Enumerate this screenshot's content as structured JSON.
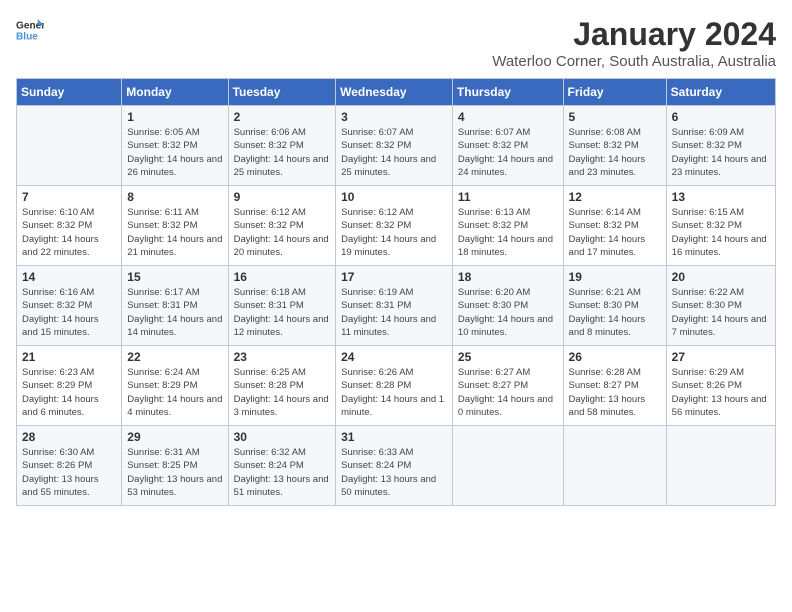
{
  "logo": {
    "general": "General",
    "blue": "Blue"
  },
  "title": "January 2024",
  "subtitle": "Waterloo Corner, South Australia, Australia",
  "days": [
    "Sunday",
    "Monday",
    "Tuesday",
    "Wednesday",
    "Thursday",
    "Friday",
    "Saturday"
  ],
  "weeks": [
    [
      {
        "day": "",
        "sunrise": "",
        "sunset": "",
        "daylight": ""
      },
      {
        "day": "1",
        "sunrise": "Sunrise: 6:05 AM",
        "sunset": "Sunset: 8:32 PM",
        "daylight": "Daylight: 14 hours and 26 minutes."
      },
      {
        "day": "2",
        "sunrise": "Sunrise: 6:06 AM",
        "sunset": "Sunset: 8:32 PM",
        "daylight": "Daylight: 14 hours and 25 minutes."
      },
      {
        "day": "3",
        "sunrise": "Sunrise: 6:07 AM",
        "sunset": "Sunset: 8:32 PM",
        "daylight": "Daylight: 14 hours and 25 minutes."
      },
      {
        "day": "4",
        "sunrise": "Sunrise: 6:07 AM",
        "sunset": "Sunset: 8:32 PM",
        "daylight": "Daylight: 14 hours and 24 minutes."
      },
      {
        "day": "5",
        "sunrise": "Sunrise: 6:08 AM",
        "sunset": "Sunset: 8:32 PM",
        "daylight": "Daylight: 14 hours and 23 minutes."
      },
      {
        "day": "6",
        "sunrise": "Sunrise: 6:09 AM",
        "sunset": "Sunset: 8:32 PM",
        "daylight": "Daylight: 14 hours and 23 minutes."
      }
    ],
    [
      {
        "day": "7",
        "sunrise": "Sunrise: 6:10 AM",
        "sunset": "Sunset: 8:32 PM",
        "daylight": "Daylight: 14 hours and 22 minutes."
      },
      {
        "day": "8",
        "sunrise": "Sunrise: 6:11 AM",
        "sunset": "Sunset: 8:32 PM",
        "daylight": "Daylight: 14 hours and 21 minutes."
      },
      {
        "day": "9",
        "sunrise": "Sunrise: 6:12 AM",
        "sunset": "Sunset: 8:32 PM",
        "daylight": "Daylight: 14 hours and 20 minutes."
      },
      {
        "day": "10",
        "sunrise": "Sunrise: 6:12 AM",
        "sunset": "Sunset: 8:32 PM",
        "daylight": "Daylight: 14 hours and 19 minutes."
      },
      {
        "day": "11",
        "sunrise": "Sunrise: 6:13 AM",
        "sunset": "Sunset: 8:32 PM",
        "daylight": "Daylight: 14 hours and 18 minutes."
      },
      {
        "day": "12",
        "sunrise": "Sunrise: 6:14 AM",
        "sunset": "Sunset: 8:32 PM",
        "daylight": "Daylight: 14 hours and 17 minutes."
      },
      {
        "day": "13",
        "sunrise": "Sunrise: 6:15 AM",
        "sunset": "Sunset: 8:32 PM",
        "daylight": "Daylight: 14 hours and 16 minutes."
      }
    ],
    [
      {
        "day": "14",
        "sunrise": "Sunrise: 6:16 AM",
        "sunset": "Sunset: 8:32 PM",
        "daylight": "Daylight: 14 hours and 15 minutes."
      },
      {
        "day": "15",
        "sunrise": "Sunrise: 6:17 AM",
        "sunset": "Sunset: 8:31 PM",
        "daylight": "Daylight: 14 hours and 14 minutes."
      },
      {
        "day": "16",
        "sunrise": "Sunrise: 6:18 AM",
        "sunset": "Sunset: 8:31 PM",
        "daylight": "Daylight: 14 hours and 12 minutes."
      },
      {
        "day": "17",
        "sunrise": "Sunrise: 6:19 AM",
        "sunset": "Sunset: 8:31 PM",
        "daylight": "Daylight: 14 hours and 11 minutes."
      },
      {
        "day": "18",
        "sunrise": "Sunrise: 6:20 AM",
        "sunset": "Sunset: 8:30 PM",
        "daylight": "Daylight: 14 hours and 10 minutes."
      },
      {
        "day": "19",
        "sunrise": "Sunrise: 6:21 AM",
        "sunset": "Sunset: 8:30 PM",
        "daylight": "Daylight: 14 hours and 8 minutes."
      },
      {
        "day": "20",
        "sunrise": "Sunrise: 6:22 AM",
        "sunset": "Sunset: 8:30 PM",
        "daylight": "Daylight: 14 hours and 7 minutes."
      }
    ],
    [
      {
        "day": "21",
        "sunrise": "Sunrise: 6:23 AM",
        "sunset": "Sunset: 8:29 PM",
        "daylight": "Daylight: 14 hours and 6 minutes."
      },
      {
        "day": "22",
        "sunrise": "Sunrise: 6:24 AM",
        "sunset": "Sunset: 8:29 PM",
        "daylight": "Daylight: 14 hours and 4 minutes."
      },
      {
        "day": "23",
        "sunrise": "Sunrise: 6:25 AM",
        "sunset": "Sunset: 8:28 PM",
        "daylight": "Daylight: 14 hours and 3 minutes."
      },
      {
        "day": "24",
        "sunrise": "Sunrise: 6:26 AM",
        "sunset": "Sunset: 8:28 PM",
        "daylight": "Daylight: 14 hours and 1 minute."
      },
      {
        "day": "25",
        "sunrise": "Sunrise: 6:27 AM",
        "sunset": "Sunset: 8:27 PM",
        "daylight": "Daylight: 14 hours and 0 minutes."
      },
      {
        "day": "26",
        "sunrise": "Sunrise: 6:28 AM",
        "sunset": "Sunset: 8:27 PM",
        "daylight": "Daylight: 13 hours and 58 minutes."
      },
      {
        "day": "27",
        "sunrise": "Sunrise: 6:29 AM",
        "sunset": "Sunset: 8:26 PM",
        "daylight": "Daylight: 13 hours and 56 minutes."
      }
    ],
    [
      {
        "day": "28",
        "sunrise": "Sunrise: 6:30 AM",
        "sunset": "Sunset: 8:26 PM",
        "daylight": "Daylight: 13 hours and 55 minutes."
      },
      {
        "day": "29",
        "sunrise": "Sunrise: 6:31 AM",
        "sunset": "Sunset: 8:25 PM",
        "daylight": "Daylight: 13 hours and 53 minutes."
      },
      {
        "day": "30",
        "sunrise": "Sunrise: 6:32 AM",
        "sunset": "Sunset: 8:24 PM",
        "daylight": "Daylight: 13 hours and 51 minutes."
      },
      {
        "day": "31",
        "sunrise": "Sunrise: 6:33 AM",
        "sunset": "Sunset: 8:24 PM",
        "daylight": "Daylight: 13 hours and 50 minutes."
      },
      {
        "day": "",
        "sunrise": "",
        "sunset": "",
        "daylight": ""
      },
      {
        "day": "",
        "sunrise": "",
        "sunset": "",
        "daylight": ""
      },
      {
        "day": "",
        "sunrise": "",
        "sunset": "",
        "daylight": ""
      }
    ]
  ]
}
